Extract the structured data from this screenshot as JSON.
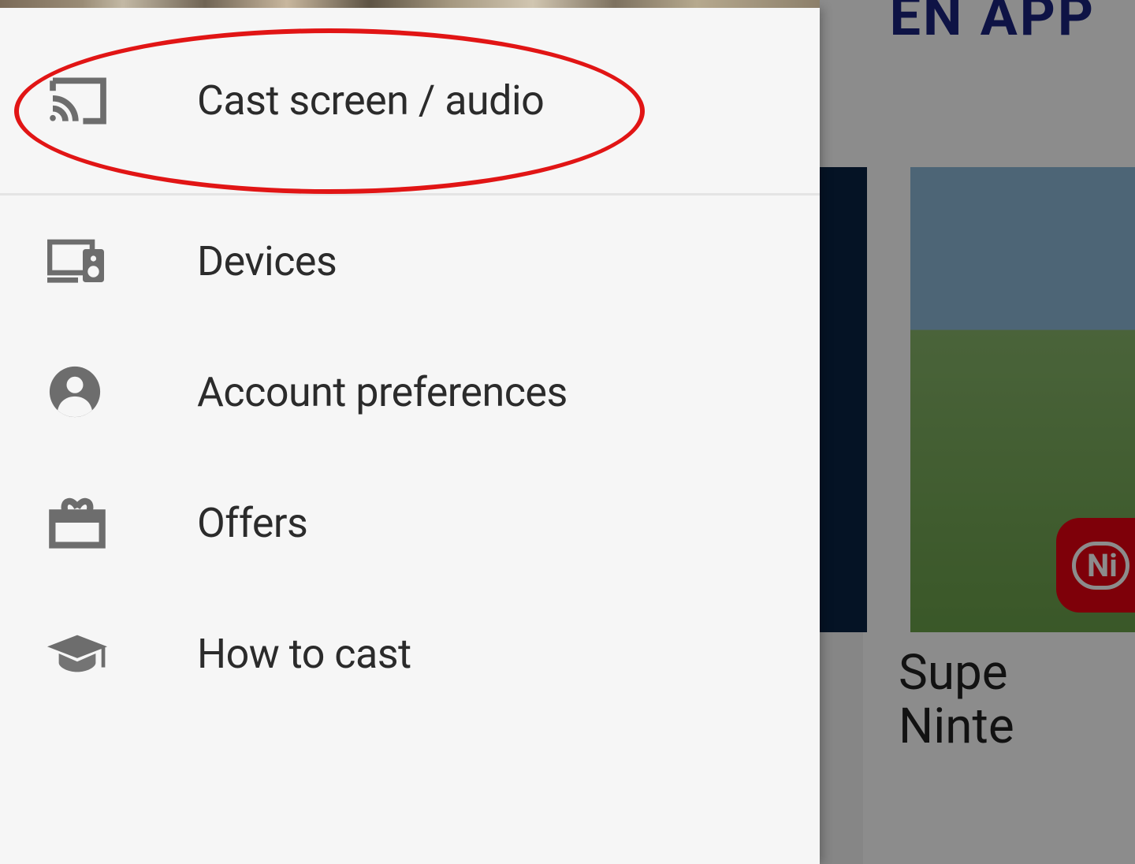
{
  "drawer": {
    "header_label": "Cast screen / audio",
    "items": [
      {
        "label": "Devices"
      },
      {
        "label": "Account preferences"
      },
      {
        "label": "Offers"
      },
      {
        "label": "How to cast"
      }
    ]
  },
  "background": {
    "top_right_text": "EN APP",
    "card2_brand_fragment": "Ni",
    "card2_title_line1": "Supe",
    "card2_title_line2": "Ninte"
  },
  "annotation": {
    "highlighted_item": "Cast screen / audio"
  }
}
